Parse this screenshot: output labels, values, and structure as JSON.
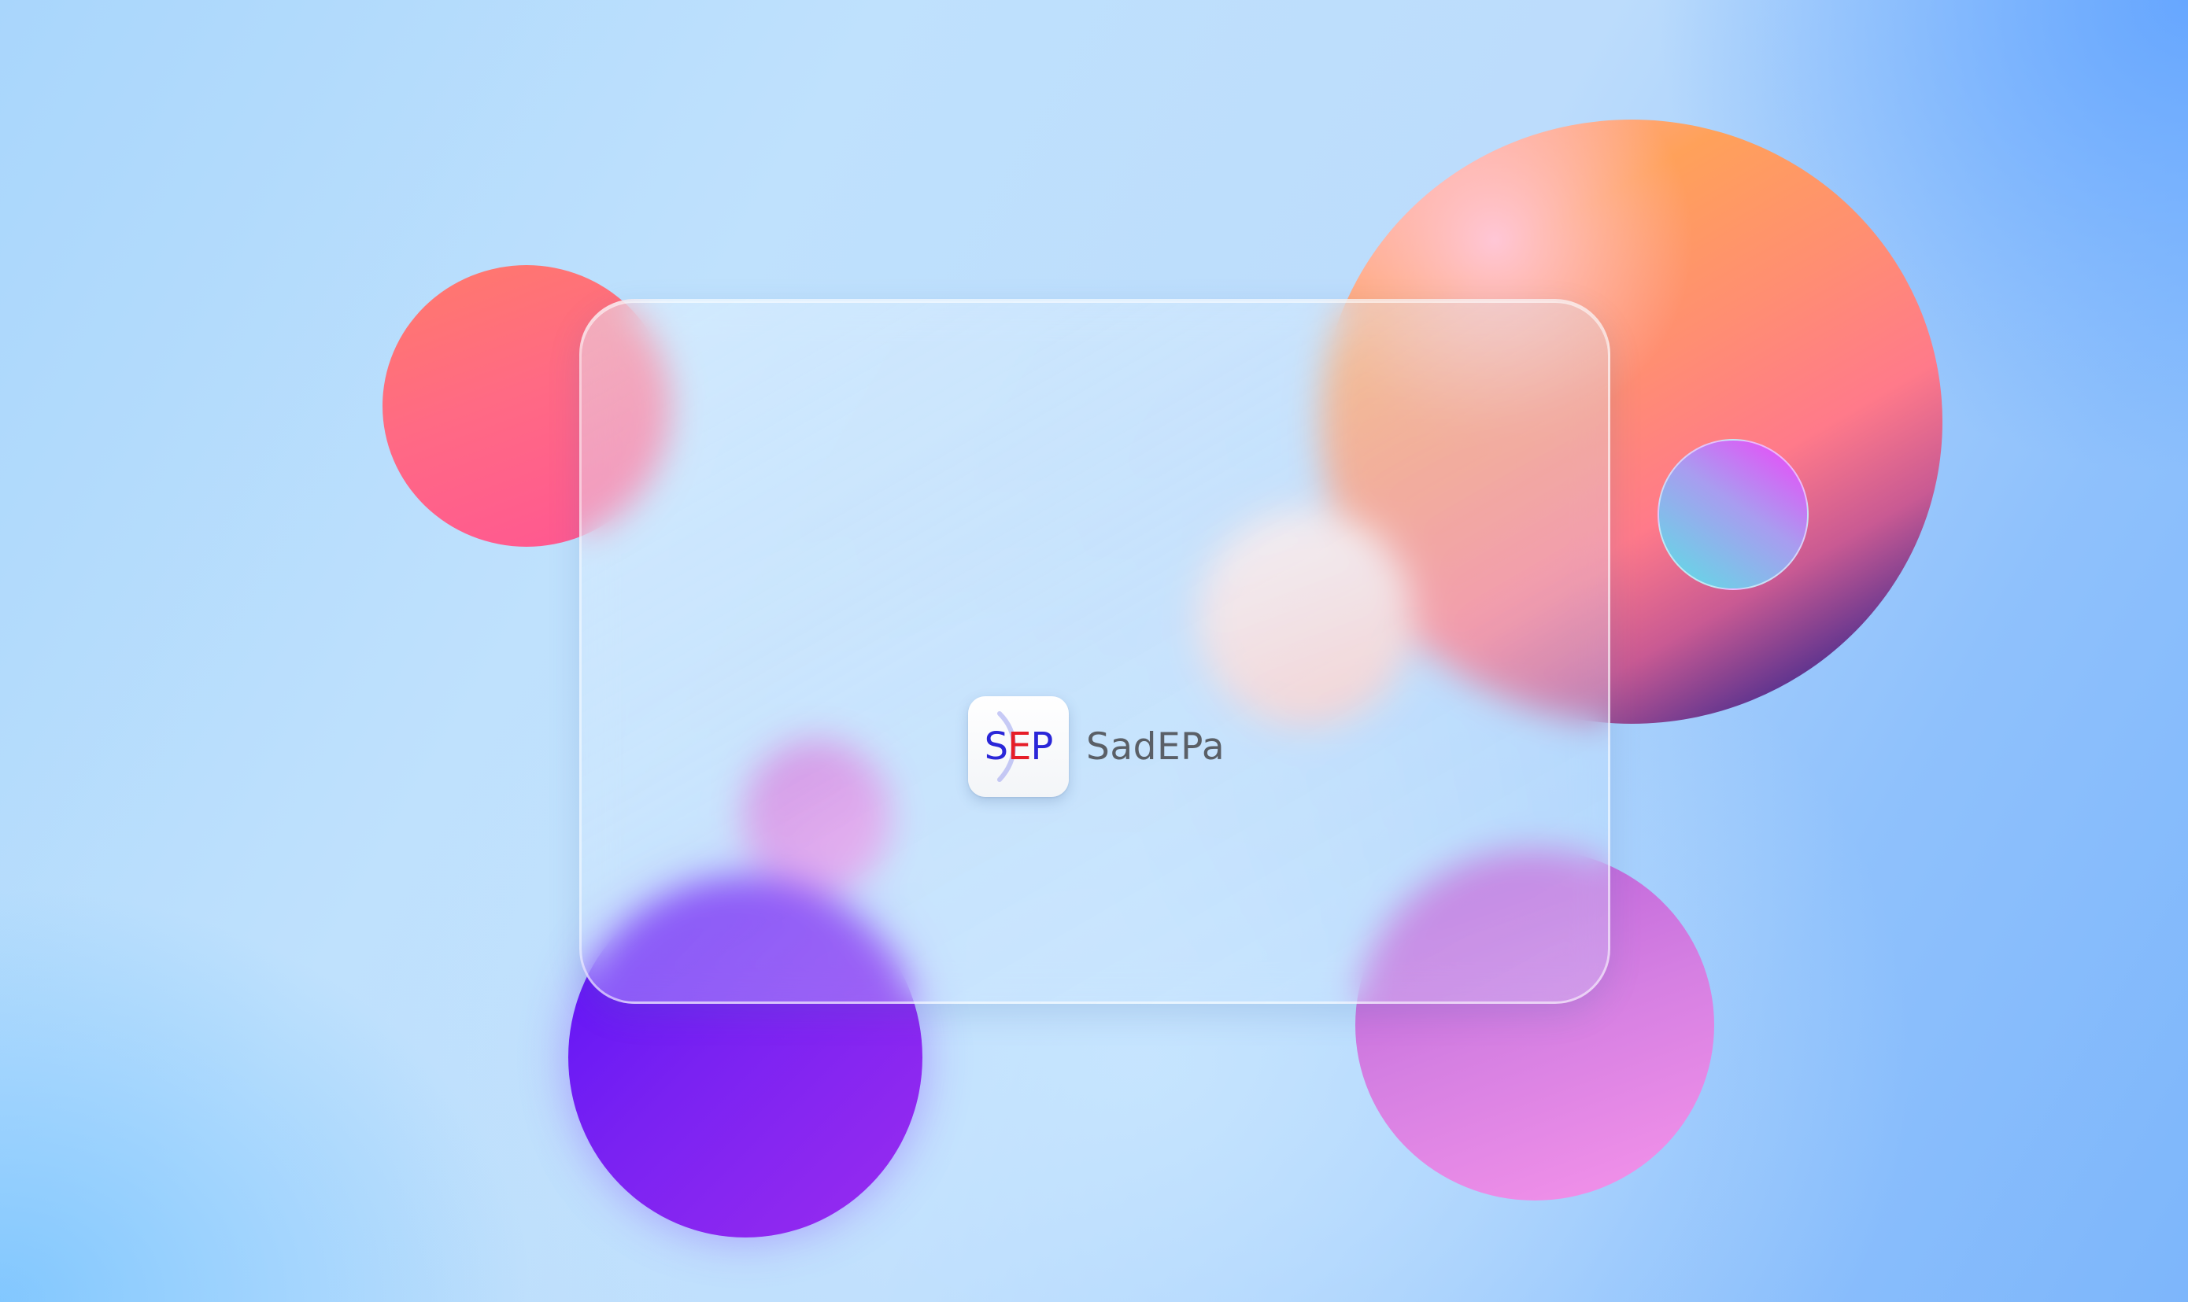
{
  "brand": {
    "logo_letters": {
      "s": "S",
      "e": "E",
      "p": "P"
    },
    "name": "SadEPa"
  },
  "colors": {
    "logo_blue": "#2a26d8",
    "logo_red": "#e61d28",
    "brand_text": "#5a5f66"
  }
}
